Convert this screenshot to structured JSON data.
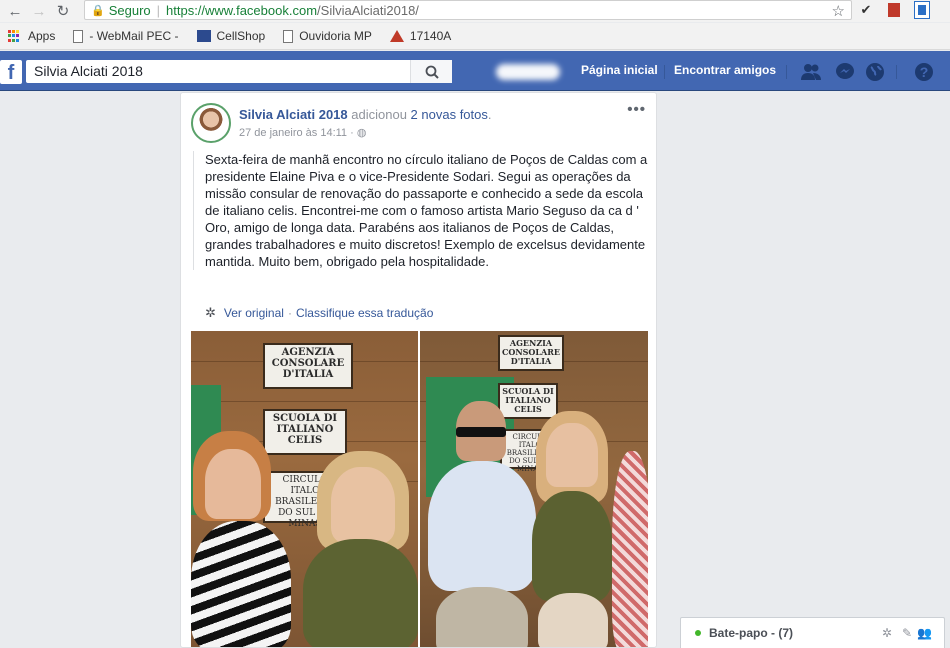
{
  "browser": {
    "security_label": "Seguro",
    "url_host": "https://www.facebook.com",
    "url_path": "/SilviaAlciati2018/"
  },
  "bookmarks": [
    {
      "label": "Apps",
      "icon": "apps-grid-icon"
    },
    {
      "label": "- WebMail PEC -",
      "icon": "document-icon"
    },
    {
      "label": "CellShop",
      "icon": "cellshop-icon"
    },
    {
      "label": "Ouvidoria MP",
      "icon": "document-icon"
    },
    {
      "label": "17140A",
      "icon": "mt-icon"
    }
  ],
  "facebook": {
    "search_value": "Silvia Alciati 2018",
    "nav_home": "Página inicial",
    "nav_find_friends": "Encontrar amigos"
  },
  "post": {
    "author": "Silvia Alciati 2018",
    "action": "adicionou",
    "photos_link": "2 novas fotos",
    "period": ".",
    "timestamp": "27 de janeiro às 14:11 ·",
    "text": "Sexta-feira de manhã encontro no círculo italiano de Poços de Caldas com a presidente Elaine Piva e o vice-Presidente Sodari. Segui as operações da missão consular de renovação do passaporte e conhecido a sede da escola de italiano celis. Encontrei-me com o famoso artista Mario Seguso da ca d ' Oro, amigo de longa data. Parabéns aos italianos de Poços de Caldas, grandes trabalhadores e muito discretos! Exemplo de excelsus devidamente mantida. Muito bem, obrigado pela hospitalidade.",
    "see_original": "Ver original",
    "separator": "·",
    "rate_translation": "Classifique essa tradução"
  },
  "photo_left": {
    "sign1": "AGENZIA CONSOLARE D'ITALIA",
    "sign2": "SCUOLA DI ITALIANO CELIS",
    "sign3": "CIRCULO ITALO BRASILEIRO DO SUL DE MINAS"
  },
  "photo_right": {
    "sign1": "AGENZIA CONSOLARE D'ITALIA",
    "sign2": "SCUOLA DI ITALIANO CELIS",
    "sign3": "CIRCULO ITALO BRASILEIRO DO SUL DE MINAS"
  },
  "chat": {
    "label": "Bate-papo - (7)",
    "status_color": "#42b72a"
  },
  "colors": {
    "fb_blue": "#4267b2",
    "link": "#365899"
  }
}
